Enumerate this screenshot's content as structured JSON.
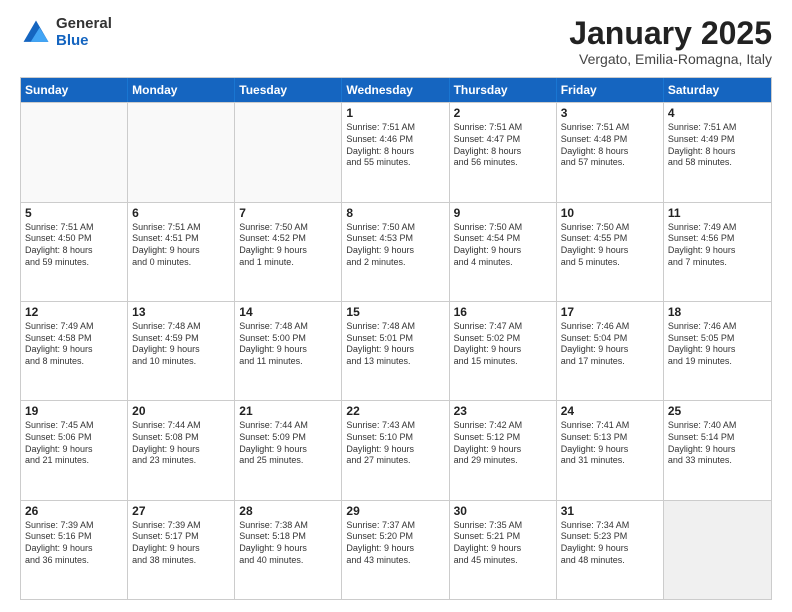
{
  "logo": {
    "general": "General",
    "blue": "Blue"
  },
  "title": "January 2025",
  "location": "Vergato, Emilia-Romagna, Italy",
  "header_days": [
    "Sunday",
    "Monday",
    "Tuesday",
    "Wednesday",
    "Thursday",
    "Friday",
    "Saturday"
  ],
  "rows": [
    [
      {
        "day": "",
        "lines": [],
        "empty": true
      },
      {
        "day": "",
        "lines": [],
        "empty": true
      },
      {
        "day": "",
        "lines": [],
        "empty": true
      },
      {
        "day": "1",
        "lines": [
          "Sunrise: 7:51 AM",
          "Sunset: 4:46 PM",
          "Daylight: 8 hours",
          "and 55 minutes."
        ]
      },
      {
        "day": "2",
        "lines": [
          "Sunrise: 7:51 AM",
          "Sunset: 4:47 PM",
          "Daylight: 8 hours",
          "and 56 minutes."
        ]
      },
      {
        "day": "3",
        "lines": [
          "Sunrise: 7:51 AM",
          "Sunset: 4:48 PM",
          "Daylight: 8 hours",
          "and 57 minutes."
        ]
      },
      {
        "day": "4",
        "lines": [
          "Sunrise: 7:51 AM",
          "Sunset: 4:49 PM",
          "Daylight: 8 hours",
          "and 58 minutes."
        ]
      }
    ],
    [
      {
        "day": "5",
        "lines": [
          "Sunrise: 7:51 AM",
          "Sunset: 4:50 PM",
          "Daylight: 8 hours",
          "and 59 minutes."
        ]
      },
      {
        "day": "6",
        "lines": [
          "Sunrise: 7:51 AM",
          "Sunset: 4:51 PM",
          "Daylight: 9 hours",
          "and 0 minutes."
        ]
      },
      {
        "day": "7",
        "lines": [
          "Sunrise: 7:50 AM",
          "Sunset: 4:52 PM",
          "Daylight: 9 hours",
          "and 1 minute."
        ]
      },
      {
        "day": "8",
        "lines": [
          "Sunrise: 7:50 AM",
          "Sunset: 4:53 PM",
          "Daylight: 9 hours",
          "and 2 minutes."
        ]
      },
      {
        "day": "9",
        "lines": [
          "Sunrise: 7:50 AM",
          "Sunset: 4:54 PM",
          "Daylight: 9 hours",
          "and 4 minutes."
        ]
      },
      {
        "day": "10",
        "lines": [
          "Sunrise: 7:50 AM",
          "Sunset: 4:55 PM",
          "Daylight: 9 hours",
          "and 5 minutes."
        ]
      },
      {
        "day": "11",
        "lines": [
          "Sunrise: 7:49 AM",
          "Sunset: 4:56 PM",
          "Daylight: 9 hours",
          "and 7 minutes."
        ]
      }
    ],
    [
      {
        "day": "12",
        "lines": [
          "Sunrise: 7:49 AM",
          "Sunset: 4:58 PM",
          "Daylight: 9 hours",
          "and 8 minutes."
        ]
      },
      {
        "day": "13",
        "lines": [
          "Sunrise: 7:48 AM",
          "Sunset: 4:59 PM",
          "Daylight: 9 hours",
          "and 10 minutes."
        ]
      },
      {
        "day": "14",
        "lines": [
          "Sunrise: 7:48 AM",
          "Sunset: 5:00 PM",
          "Daylight: 9 hours",
          "and 11 minutes."
        ]
      },
      {
        "day": "15",
        "lines": [
          "Sunrise: 7:48 AM",
          "Sunset: 5:01 PM",
          "Daylight: 9 hours",
          "and 13 minutes."
        ]
      },
      {
        "day": "16",
        "lines": [
          "Sunrise: 7:47 AM",
          "Sunset: 5:02 PM",
          "Daylight: 9 hours",
          "and 15 minutes."
        ]
      },
      {
        "day": "17",
        "lines": [
          "Sunrise: 7:46 AM",
          "Sunset: 5:04 PM",
          "Daylight: 9 hours",
          "and 17 minutes."
        ]
      },
      {
        "day": "18",
        "lines": [
          "Sunrise: 7:46 AM",
          "Sunset: 5:05 PM",
          "Daylight: 9 hours",
          "and 19 minutes."
        ]
      }
    ],
    [
      {
        "day": "19",
        "lines": [
          "Sunrise: 7:45 AM",
          "Sunset: 5:06 PM",
          "Daylight: 9 hours",
          "and 21 minutes."
        ]
      },
      {
        "day": "20",
        "lines": [
          "Sunrise: 7:44 AM",
          "Sunset: 5:08 PM",
          "Daylight: 9 hours",
          "and 23 minutes."
        ]
      },
      {
        "day": "21",
        "lines": [
          "Sunrise: 7:44 AM",
          "Sunset: 5:09 PM",
          "Daylight: 9 hours",
          "and 25 minutes."
        ]
      },
      {
        "day": "22",
        "lines": [
          "Sunrise: 7:43 AM",
          "Sunset: 5:10 PM",
          "Daylight: 9 hours",
          "and 27 minutes."
        ]
      },
      {
        "day": "23",
        "lines": [
          "Sunrise: 7:42 AM",
          "Sunset: 5:12 PM",
          "Daylight: 9 hours",
          "and 29 minutes."
        ]
      },
      {
        "day": "24",
        "lines": [
          "Sunrise: 7:41 AM",
          "Sunset: 5:13 PM",
          "Daylight: 9 hours",
          "and 31 minutes."
        ]
      },
      {
        "day": "25",
        "lines": [
          "Sunrise: 7:40 AM",
          "Sunset: 5:14 PM",
          "Daylight: 9 hours",
          "and 33 minutes."
        ]
      }
    ],
    [
      {
        "day": "26",
        "lines": [
          "Sunrise: 7:39 AM",
          "Sunset: 5:16 PM",
          "Daylight: 9 hours",
          "and 36 minutes."
        ]
      },
      {
        "day": "27",
        "lines": [
          "Sunrise: 7:39 AM",
          "Sunset: 5:17 PM",
          "Daylight: 9 hours",
          "and 38 minutes."
        ]
      },
      {
        "day": "28",
        "lines": [
          "Sunrise: 7:38 AM",
          "Sunset: 5:18 PM",
          "Daylight: 9 hours",
          "and 40 minutes."
        ]
      },
      {
        "day": "29",
        "lines": [
          "Sunrise: 7:37 AM",
          "Sunset: 5:20 PM",
          "Daylight: 9 hours",
          "and 43 minutes."
        ]
      },
      {
        "day": "30",
        "lines": [
          "Sunrise: 7:35 AM",
          "Sunset: 5:21 PM",
          "Daylight: 9 hours",
          "and 45 minutes."
        ]
      },
      {
        "day": "31",
        "lines": [
          "Sunrise: 7:34 AM",
          "Sunset: 5:23 PM",
          "Daylight: 9 hours",
          "and 48 minutes."
        ]
      },
      {
        "day": "",
        "lines": [],
        "empty": true,
        "shaded": true
      }
    ]
  ]
}
